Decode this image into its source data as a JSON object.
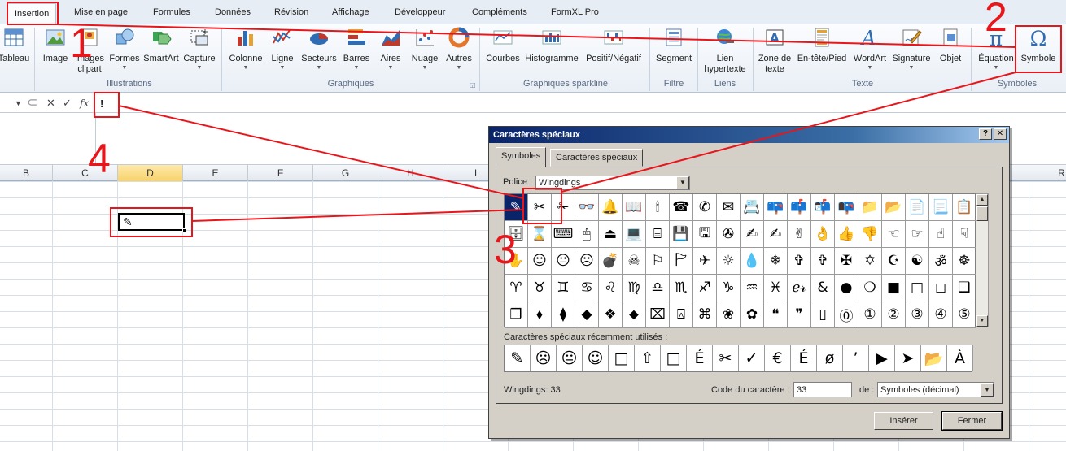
{
  "tabs": [
    "Insertion",
    "Mise en page",
    "Formules",
    "Données",
    "Révision",
    "Affichage",
    "Développeur",
    "Compléments",
    "FormXL Pro"
  ],
  "ribbon": {
    "buttons": [
      {
        "label": "Tableau",
        "icon": "table-icon"
      },
      {
        "label": "Image",
        "icon": "image-icon"
      },
      {
        "label": "Images clipart",
        "icon": "clipart-icon"
      },
      {
        "label": "Formes",
        "icon": "shapes-icon"
      },
      {
        "label": "SmartArt",
        "icon": "smartart-icon"
      },
      {
        "label": "Capture",
        "icon": "screenshot-icon"
      },
      {
        "label": "Colonne",
        "icon": "column-chart-icon"
      },
      {
        "label": "Ligne",
        "icon": "line-chart-icon"
      },
      {
        "label": "Secteurs",
        "icon": "pie-chart-icon"
      },
      {
        "label": "Barres",
        "icon": "bar-chart-icon"
      },
      {
        "label": "Aires",
        "icon": "area-chart-icon"
      },
      {
        "label": "Nuage",
        "icon": "scatter-chart-icon"
      },
      {
        "label": "Autres",
        "icon": "other-charts-icon"
      },
      {
        "label": "Courbes",
        "icon": "sparkline-line-icon"
      },
      {
        "label": "Histogramme",
        "icon": "sparkline-column-icon"
      },
      {
        "label": "Positif/Négatif",
        "icon": "sparkline-winloss-icon"
      },
      {
        "label": "Segment",
        "icon": "slicer-icon"
      },
      {
        "label": "Lien hypertexte",
        "icon": "hyperlink-icon"
      },
      {
        "label": "Zone de texte",
        "icon": "textbox-icon"
      },
      {
        "label": "En-tête/Pied",
        "icon": "header-footer-icon"
      },
      {
        "label": "WordArt",
        "icon": "wordart-icon"
      },
      {
        "label": "Signature",
        "icon": "signature-icon"
      },
      {
        "label": "Objet",
        "icon": "object-icon"
      },
      {
        "label": "Équation",
        "icon": "equation-icon"
      },
      {
        "label": "Symbole",
        "icon": "omega-icon"
      }
    ],
    "groups": [
      "Illustrations",
      "Graphiques",
      "Graphiques sparkline",
      "Filtre",
      "Liens",
      "Texte",
      "Symboles"
    ]
  },
  "formula_bar": {
    "value": "!"
  },
  "columns": [
    "B",
    "C",
    "D",
    "E",
    "F",
    "G",
    "H",
    "I",
    "R"
  ],
  "active_column": "D",
  "cell_glyph": "✎",
  "dialog": {
    "title": "Caractères spéciaux",
    "title_buttons": [
      "?",
      "✕"
    ],
    "tabs": [
      "Symboles",
      "Caractères spéciaux"
    ],
    "font_label": "Police :",
    "font_value": "Wingdings",
    "symbols": [
      "✎",
      "✂",
      "✁",
      "👓",
      "🔔",
      "📖",
      "🕯",
      "☎",
      "✆",
      "✉",
      "📇",
      "📪",
      "📫",
      "📬",
      "📭",
      "📁",
      "📂",
      "📄",
      "📃",
      "📋",
      "🗄",
      "⌛",
      "⌨",
      "🖱",
      "⏏",
      "💻",
      "⌸",
      "💾",
      "🖫",
      "✇",
      "✍",
      "✍",
      "✌",
      "👌",
      "👍",
      "👎",
      "☜",
      "☞",
      "☝",
      "☟",
      "✋",
      "☺",
      "😐",
      "☹",
      "💣",
      "☠",
      "⚐",
      "🏱",
      "✈",
      "☼",
      "💧",
      "❄",
      "✞",
      "✞",
      "✠",
      "✡",
      "☪",
      "☯",
      "ॐ",
      "☸",
      "♈",
      "♉",
      "♊",
      "♋",
      "♌",
      "♍",
      "♎",
      "♏",
      "♐",
      "♑",
      "♒",
      "♓",
      "ℯ𝓇",
      "&",
      "●",
      "❍",
      "■",
      "□",
      "◻",
      "❑",
      "❒",
      "⬧",
      "⧫",
      "◆",
      "❖",
      "⬥",
      "⌧",
      "⍓",
      "⌘",
      "❀",
      "✿",
      "❝",
      "❞",
      "▯",
      "⓪",
      "①",
      "②",
      "③",
      "④",
      "⑤"
    ],
    "recent_label": "Caractères spéciaux récemment utilisés :",
    "recent": [
      "✎",
      "☹",
      "😐",
      "☺",
      "□",
      "⇧",
      "□",
      "É",
      "✂",
      "✓",
      "€",
      "É",
      "ø",
      "’",
      "▶",
      "➤",
      "📂",
      "À",
      "☯"
    ],
    "status_font": "Wingdings: 33",
    "code_label": "Code du caractère :",
    "code_value": "33",
    "from_label": "de :",
    "from_value": "Symboles (décimal)",
    "insert_button": "Insérer",
    "close_button": "Fermer"
  },
  "annotations": [
    "1",
    "2",
    "3",
    "4"
  ],
  "colors": {
    "annotation": "#e8161b",
    "title_bar": "#0a246a",
    "selected_column": "#f7d26a"
  }
}
